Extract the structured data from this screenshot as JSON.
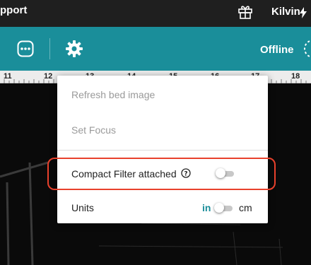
{
  "header": {
    "support_label": "pport",
    "user_name": "Kilvin"
  },
  "toolbar": {
    "status_label": "Offline"
  },
  "ruler": {
    "labels": [
      "11",
      "12",
      "13",
      "14",
      "15",
      "16",
      "17",
      "18"
    ]
  },
  "menu": {
    "refresh_label": "Refresh bed image",
    "focus_label": "Set Focus",
    "filter_label": "Compact Filter attached",
    "filter_enabled": false,
    "units_label": "Units",
    "units_left": "in",
    "units_right": "cm",
    "units_selected": "in"
  },
  "colors": {
    "accent": "#1a8e9a",
    "highlight": "#e8412c"
  }
}
